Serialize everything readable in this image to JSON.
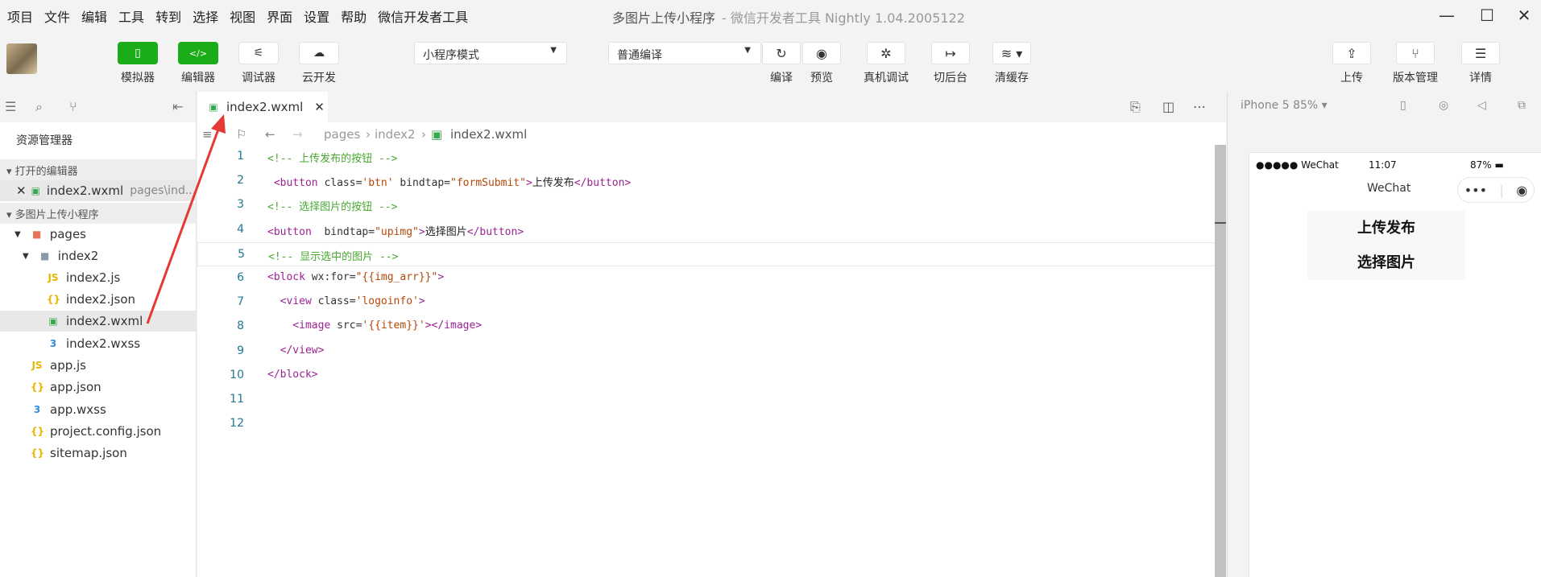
{
  "menubar": {
    "items": [
      "项目",
      "文件",
      "编辑",
      "工具",
      "转到",
      "选择",
      "视图",
      "界面",
      "设置",
      "帮助",
      "微信开发者工具"
    ],
    "title": "多图片上传小程序",
    "subtitle": "- 微信开发者工具 Nightly 1.04.2005122"
  },
  "toolbar": {
    "simulator": "模拟器",
    "editor": "编辑器",
    "debugger": "调试器",
    "cloud": "云开发",
    "mode_select": "小程序模式",
    "compile_select": "普通编译",
    "compile": "编译",
    "preview": "预览",
    "remote_debug": "真机调试",
    "background": "切后台",
    "clear_cache": "清缓存",
    "upload": "上传",
    "version": "版本管理",
    "details": "详情"
  },
  "sidebar": {
    "title": "资源管理器",
    "open_editors": "打开的编辑器",
    "open_file": "index2.wxml",
    "open_file_path": "pages\\ind...",
    "project": "多图片上传小程序",
    "tree": {
      "pages": "pages",
      "index2": "index2",
      "index2_js": "index2.js",
      "index2_json": "index2.json",
      "index2_wxml": "index2.wxml",
      "index2_wxss": "index2.wxss",
      "app_js": "app.js",
      "app_json": "app.json",
      "app_wxss": "app.wxss",
      "project_config": "project.config.json",
      "sitemap": "sitemap.json"
    }
  },
  "editor": {
    "tab": "index2.wxml",
    "breadcrumb": [
      "pages",
      "index2",
      "index2.wxml"
    ],
    "lines": [
      {
        "n": "1",
        "parts": [
          [
            "c-com",
            "<!-- 上传发布的按钮 -->"
          ]
        ]
      },
      {
        "n": "2",
        "parts": [
          [
            "c-tag",
            " <button"
          ],
          [
            "c-attr",
            " class="
          ],
          [
            "c-str",
            "'btn'"
          ],
          [
            "c-attr",
            " bindtap="
          ],
          [
            "c-str",
            "\"formSubmit\""
          ],
          [
            "c-tag",
            ">"
          ],
          [
            "c-txt",
            "上传发布"
          ],
          [
            "c-tag",
            "</button>"
          ]
        ]
      },
      {
        "n": "3",
        "parts": [
          [
            "c-com",
            "<!-- 选择图片的按钮 -->"
          ]
        ]
      },
      {
        "n": "4",
        "parts": [
          [
            "c-tag",
            "<button"
          ],
          [
            "c-attr",
            "  bindtap="
          ],
          [
            "c-str",
            "\"upimg\""
          ],
          [
            "c-tag",
            ">"
          ],
          [
            "c-txt",
            "选择图片"
          ],
          [
            "c-tag",
            "</button>"
          ]
        ]
      },
      {
        "n": "5",
        "parts": [
          [
            "c-com",
            "<!-- 显示选中的图片 -->"
          ]
        ]
      },
      {
        "n": "6",
        "parts": [
          [
            "c-tag",
            "<block"
          ],
          [
            "c-attr",
            " wx:for="
          ],
          [
            "c-str",
            "\"{{img_arr}}\""
          ],
          [
            "c-tag",
            ">"
          ]
        ]
      },
      {
        "n": "7",
        "parts": [
          [
            "c-tag",
            "  <view"
          ],
          [
            "c-attr",
            " class="
          ],
          [
            "c-str",
            "'logoinfo'"
          ],
          [
            "c-tag",
            ">"
          ]
        ]
      },
      {
        "n": "8",
        "parts": [
          [
            "c-tag",
            "    <image"
          ],
          [
            "c-attr",
            " src="
          ],
          [
            "c-str",
            "'{{item}}'"
          ],
          [
            "c-tag",
            "></image>"
          ]
        ]
      },
      {
        "n": "9",
        "parts": [
          [
            "c-tag",
            "  </view>"
          ]
        ]
      },
      {
        "n": "10",
        "parts": [
          [
            "c-tag",
            "</block>"
          ]
        ]
      },
      {
        "n": "11",
        "parts": []
      },
      {
        "n": "12",
        "parts": []
      }
    ]
  },
  "simulator": {
    "device": "iPhone 5 85% ▾",
    "carrier": "●●●●● WeChat",
    "time": "11:07",
    "battery": "87%",
    "nav_title": "WeChat",
    "btn_upload": "上传发布",
    "btn_select": "选择图片"
  },
  "colors": {
    "accent_green": "#1aad19",
    "arrow": "#e53935"
  }
}
